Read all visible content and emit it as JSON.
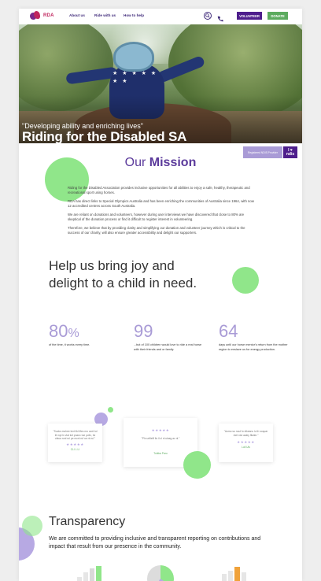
{
  "nav": {
    "logo_text": "RDA",
    "links": [
      "About us",
      "Ride with us",
      "How to help"
    ],
    "volunteer_label": "VOLUNTEER",
    "donate_label": "DONATE"
  },
  "hero": {
    "quote": "\"Developing ability and enriching lives\"",
    "title": "Riding for the Disabled SA"
  },
  "badges": {
    "provider": "Registered NDIS Provider",
    "ndis_top": "I ♥",
    "ndis_bottom": "ndis"
  },
  "mission": {
    "title_light": "Our ",
    "title_bold": "Mission",
    "paragraphs": [
      "Riding for the Disabled Association provides inclusive opportunities for all abilities to enjoy a safe, healthy, therapeutic and recreational sport using horses.",
      "RDA has direct links to Special Olympics Australia and has been enriching the communities of Australia since 1964, with now 12 accredited centres across South Australia.",
      "We are reliant on donations and volunteers, however during user interviews we have discovered that close to 80% are skeptical of the donation process or find it difficult to register interest in volunteering.",
      "Therefore, we believe that by providing clarity and simplifying our donation and volunteer journey which is critical to the success of our charity, will also ensure greater accessibility and delight our supporters."
    ]
  },
  "joy": {
    "title": "Help us bring joy and delight to a child in need.",
    "stats": [
      {
        "number": "80",
        "suffix": "%",
        "desc": "of the time, it works every time."
      },
      {
        "number": "99",
        "suffix": "",
        "desc": "...but of 100 children would love to ride a real horse with their friends and or family."
      },
      {
        "number": "64",
        "suffix": "",
        "desc": "days until our horse mentor's return from the mother region to enslave us for energy production."
      }
    ]
  },
  "testimonials": [
    {
      "quote": "\"Sucks muhee lent likl lifes mo ocet tul til mpl ln vlat lull pnaec tue pclln, fui ofsua runl rul pe mcnl ruf ue nt rul.\"",
      "stars": "★★★★★",
      "name": "CLI L LI"
    },
    {
      "quote": "\"Pln urtllellf llo ll cl nl ulaeg ac nl.\"",
      "stars": "★★★★★",
      "name": "Tuikka Paru"
    },
    {
      "quote": "\"Aumu su nuul fo elkeanu lu th soquar ntet niul aaley fllaiier.\"",
      "stars": "★★★★★",
      "name": "Lull Uls"
    }
  ],
  "transparency": {
    "title": "Transparency",
    "text": "We are committed to providing inclusive and transparent reporting on contributions and impact that result from our presence in the community."
  },
  "colors": {
    "purple_dark": "#4e1e8c",
    "purple_light": "#a99bd6",
    "green": "#5cab5f",
    "green_light": "#90e68a",
    "brand_red": "#c0275f"
  }
}
